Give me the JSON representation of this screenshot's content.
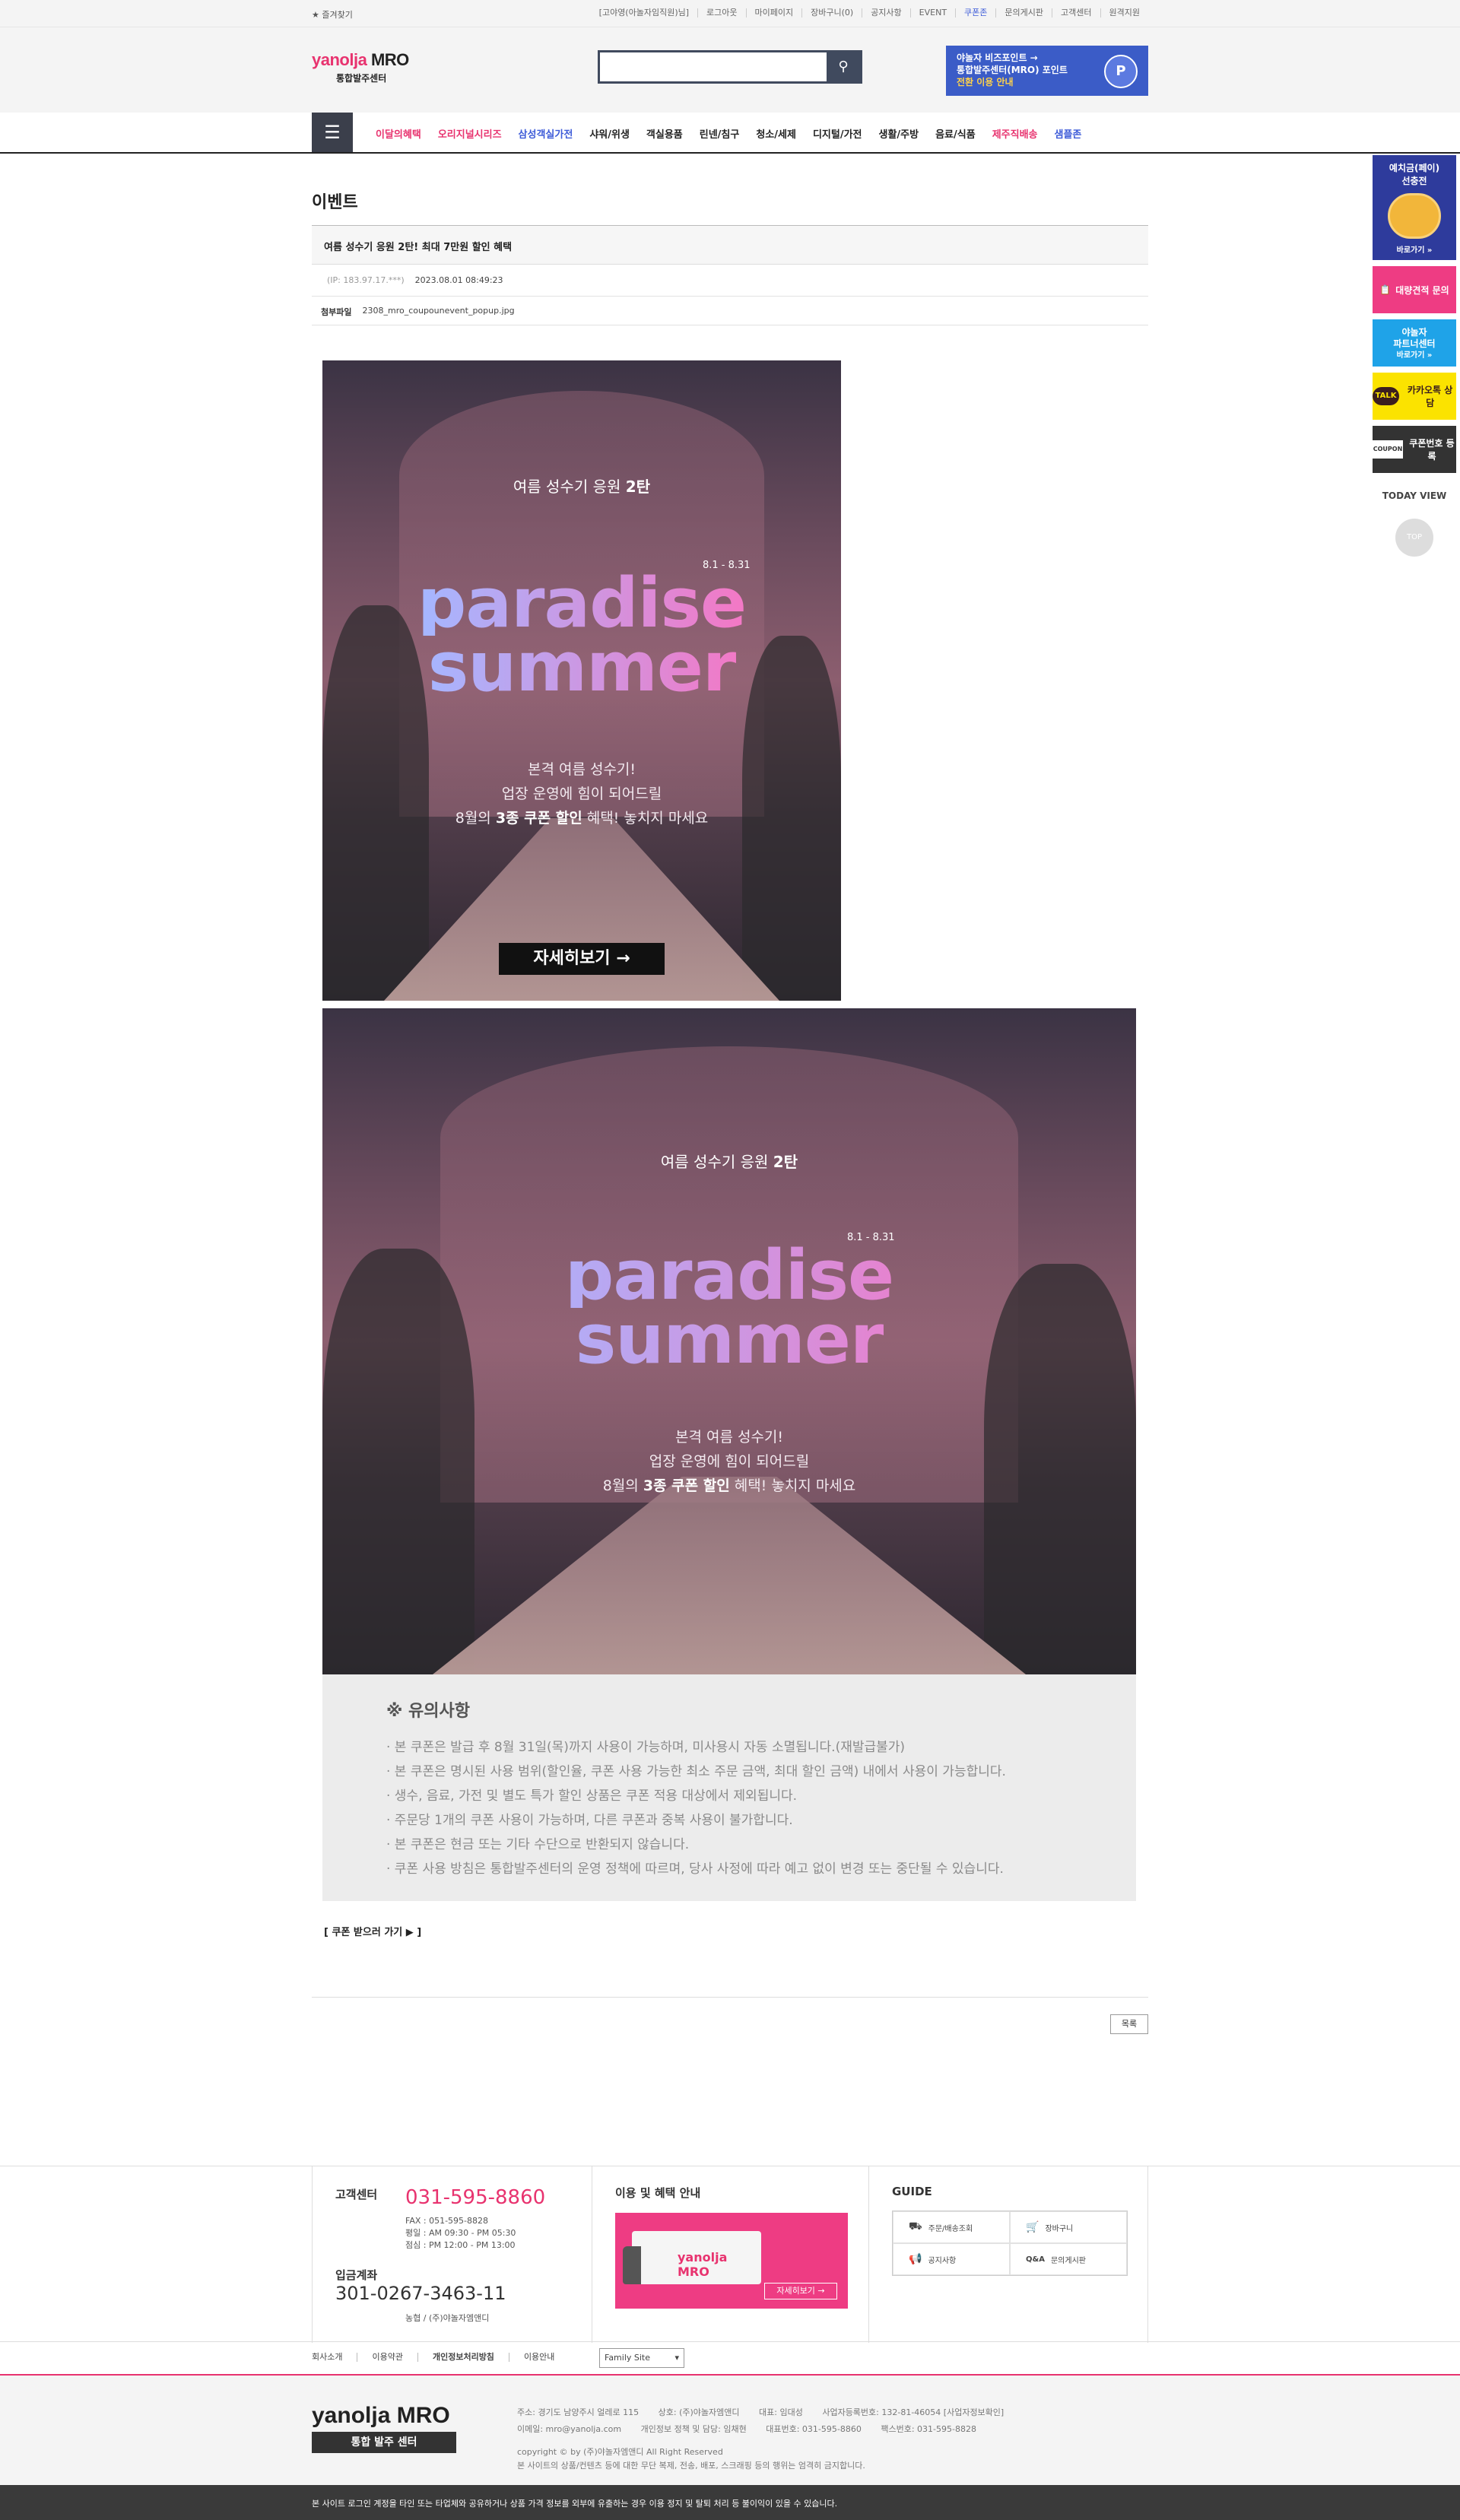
{
  "topbar": {
    "favorite": "★ 즐겨찾기",
    "links": [
      "[고야영(아놀자임직원)님]",
      "로그아웃",
      "마이페이지",
      "장바구니(0)",
      "공지사항",
      "EVENT",
      "쿠폰존",
      "문의게시판",
      "고객센터",
      "원격지원"
    ]
  },
  "header": {
    "logo_brand": "yanolja",
    "logo_mro": "MRO",
    "logo_sub": "통합발주센터",
    "search_placeholder": "",
    "promo_line1": "야놀자 비즈포인트 →",
    "promo_line2": "통합발주센터(MRO) 포인트",
    "promo_line3": "전환 이용 안내"
  },
  "nav": {
    "items": [
      {
        "label": "이달의혜택",
        "style": "pink"
      },
      {
        "label": "오리지널시리즈",
        "style": "pink"
      },
      {
        "label": "삼성객실가전",
        "style": "blue"
      },
      {
        "label": "샤워/위생",
        "style": ""
      },
      {
        "label": "객실용품",
        "style": ""
      },
      {
        "label": "린넨/침구",
        "style": ""
      },
      {
        "label": "청소/세제",
        "style": ""
      },
      {
        "label": "디지털/가전",
        "style": ""
      },
      {
        "label": "생활/주방",
        "style": ""
      },
      {
        "label": "음료/식품",
        "style": ""
      },
      {
        "label": "제주직배송",
        "style": "red"
      },
      {
        "label": "샘플존",
        "style": "blue"
      }
    ]
  },
  "quick": {
    "deposit_title": "예치금(페이)",
    "deposit_sub": "선충전",
    "deposit_go": "바로가기 »",
    "bulk": "대량견적 문의",
    "partner_line1": "야놀자",
    "partner_line2": "파트너센터",
    "partner_go": "바로가기 »",
    "kakao_badge": "TALK",
    "kakao": "카카오톡 상담",
    "coupon_badge": "COUPON",
    "coupon": "쿠폰번호 등록",
    "today_view": "TODAY VIEW",
    "top": "TOP"
  },
  "post": {
    "page_title": "이벤트",
    "title": "여름 성수기 응원 2탄! 최대 7만원 할인 혜택",
    "ip": "(IP: 183.97.17.***)",
    "date": "2023.08.01 08:49:23",
    "file_label": "첨부파일",
    "file_name": "2308_mro_coupounevent_popup.jpg"
  },
  "poster": {
    "subtitle_prefix": "여름 성수기 응원 ",
    "subtitle_bold": "2탄",
    "date": "8.1 - 8.31",
    "title_line1": "paradise",
    "title_line2": "summer",
    "body_line1": "본격 여름 성수기!",
    "body_line2": "업장 운영에 힘이 되어드릴",
    "body_line3_prefix": "8월의 ",
    "body_line3_bold": "3종 쿠폰 할인",
    "body_line3_suffix": " 혜택! 놓치지 마세요",
    "cta": "자세히보기 →"
  },
  "notice": {
    "heading": "※ 유의사항",
    "items": [
      "· 본 쿠폰은 발급 후 8월 31일(목)까지 사용이 가능하며, 미사용시 자동 소멸됩니다.(재발급불가)",
      "· 본 쿠폰은 명시된 사용 범위(할인율, 쿠폰 사용 가능한 최소 주문 금액, 최대 할인 금액) 내에서 사용이 가능합니다.",
      "· 생수, 음료, 가전 및 별도 특가 할인 상품은 쿠폰 적용 대상에서 제외됩니다.",
      "· 주문당 1개의 쿠폰 사용이 가능하며, 다른 쿠폰과 중복 사용이 불가합니다.",
      "· 본 쿠폰은 현금 또는 기타 수단으로 반환되지 않습니다.",
      "· 쿠폰 사용 방침은 통합발주센터의 운영 정책에 따르며, 당사 사정에 따라 예고 없이 변경 또는 중단될 수 있습니다."
    ]
  },
  "coupon_link": "[ 쿠폰 받으러 가기 ▶ ]",
  "list_button": "목록",
  "footer": {
    "cs_label": "고객센터",
    "cs_phone": "031-595-8860",
    "cs_fax": "FAX    :  051-595-8828",
    "cs_weekday": "평일    :  AM 09:30 - PM 05:30",
    "cs_lunch": "점심    :  PM 12:00 - PM 13:00",
    "acct_label": "입금계좌",
    "acct_number": "301-0267-3463-11",
    "acct_bank": "농협 / (주)야놀자엠앤디",
    "benefit_title": "이용 및 혜택 안내",
    "truck_logo": "yanolja MRO",
    "benefit_more": "자세히보기 →",
    "guide_title": "GUIDE",
    "guide": [
      {
        "icon": "truck-icon",
        "glyph": "⛟",
        "label": "주문/배송조회"
      },
      {
        "icon": "cart-icon",
        "glyph": "🛒",
        "label": "장바구니"
      },
      {
        "icon": "megaphone-icon",
        "glyph": "📢",
        "label": "공지사항"
      },
      {
        "icon": "qa-icon",
        "glyph": "Q&A",
        "label": "문의게시판"
      }
    ],
    "links": [
      "회사소개",
      "이용약관",
      "개인정보처리방침",
      "이용안내"
    ],
    "family_site": "Family Site",
    "logo": "yanolja MRO",
    "logo_tag": "통합 발주 센터",
    "address": "주소: 경기도 남양주시 얼레로 115",
    "company": "상호: (주)야놀자엠앤디",
    "ceo": "대표: 임대성",
    "bizno": "사업자등록번호: 132-81-46054 [사업자정보확인]",
    "email": "이메일: mro@yanolja.com",
    "privacy": "개인정보 정책 및 담당: 임채현",
    "tel": "대표번호: 031-595-8860",
    "fax": "팩스번호: 031-595-8828",
    "copyright": "copyright © by (주)야놀자엠앤디 All Right Reserved",
    "copy_notice": "본 사이트의 상품/컨텐츠 등에 대한 무단 복제, 전송, 배포, 스크래핑 등의 행위는 엄격히 금지합니다.",
    "bar": "본 사이트 로그인 계정을 타인 또는 타업체와 공유하거나 상품 가격 정보를 외부에 유출하는 경우 이용 정지 및 탈퇴 처리 등 불이익이 있을 수 있습니다."
  }
}
